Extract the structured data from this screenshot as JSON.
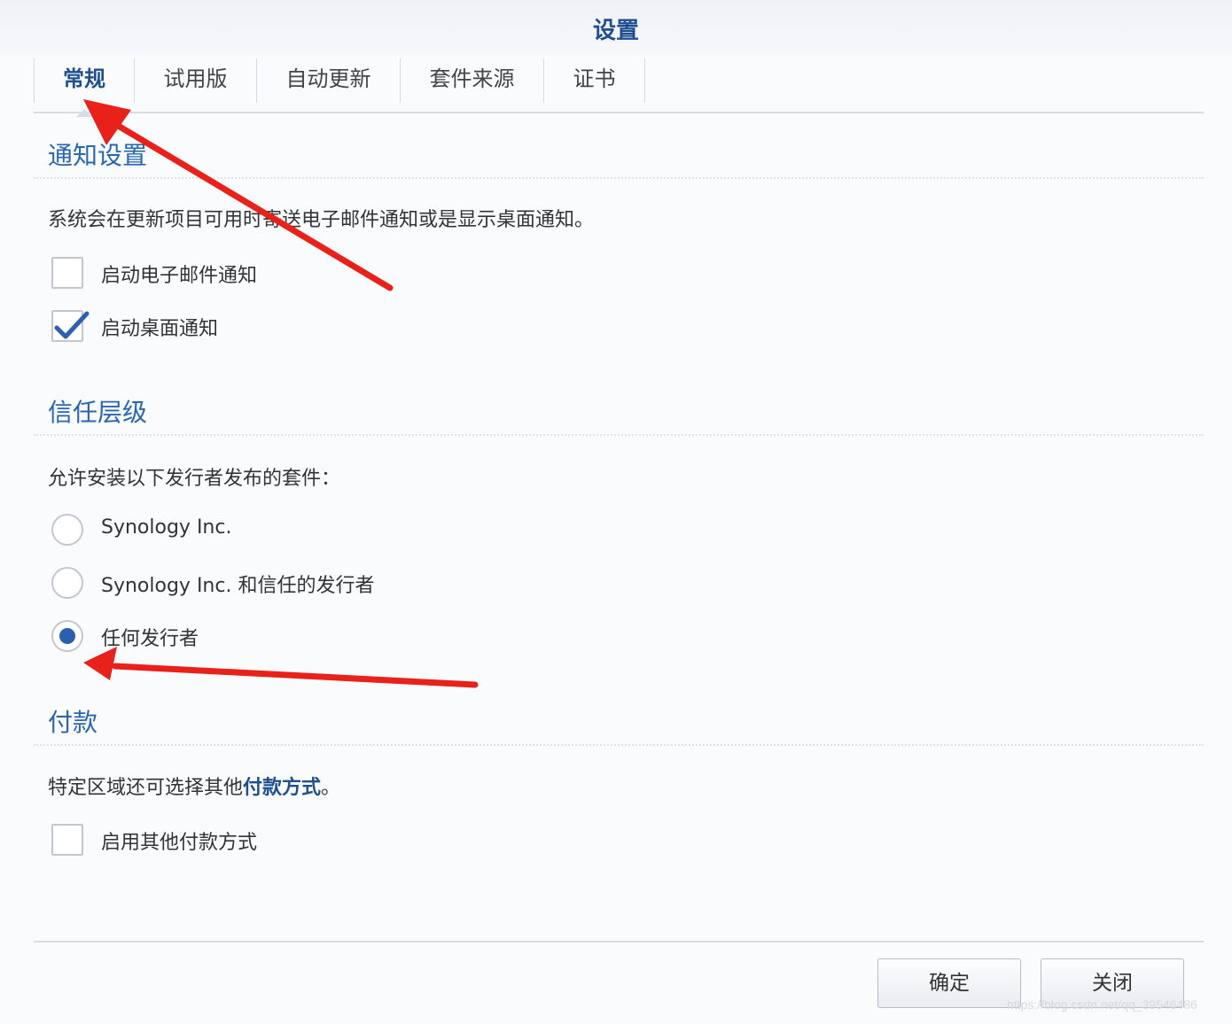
{
  "window": {
    "title": "设置"
  },
  "tabs": [
    {
      "label": "常规",
      "active": true
    },
    {
      "label": "试用版",
      "active": false
    },
    {
      "label": "自动更新",
      "active": false
    },
    {
      "label": "套件来源",
      "active": false
    },
    {
      "label": "证书",
      "active": false
    }
  ],
  "notification": {
    "title": "通知设置",
    "description": "系统会在更新项目可用时寄送电子邮件通知或是显示桌面通知。",
    "options": [
      {
        "label": "启动电子邮件通知",
        "checked": false
      },
      {
        "label": "启动桌面通知",
        "checked": true
      }
    ]
  },
  "trust": {
    "title": "信任层级",
    "description": "允许安装以下发行者发布的套件：",
    "options": [
      {
        "label": "Synology Inc.",
        "selected": false
      },
      {
        "label": "Synology Inc. 和信任的发行者",
        "selected": false
      },
      {
        "label": "任何发行者",
        "selected": true
      }
    ]
  },
  "payment": {
    "title": "付款",
    "description_prefix": "特定区域还可选择其他",
    "description_link": "付款方式",
    "description_suffix": "。",
    "options": [
      {
        "label": "启用其他付款方式",
        "checked": false
      }
    ]
  },
  "buttons": {
    "ok": "确定",
    "close": "关闭"
  },
  "watermark": "https://blog.csdn.net/qq_39546486",
  "colors": {
    "accent": "#2866b1",
    "title": "#1f4f8f",
    "check": "#2d5fb0",
    "annotation_arrow": "#e8221a"
  }
}
